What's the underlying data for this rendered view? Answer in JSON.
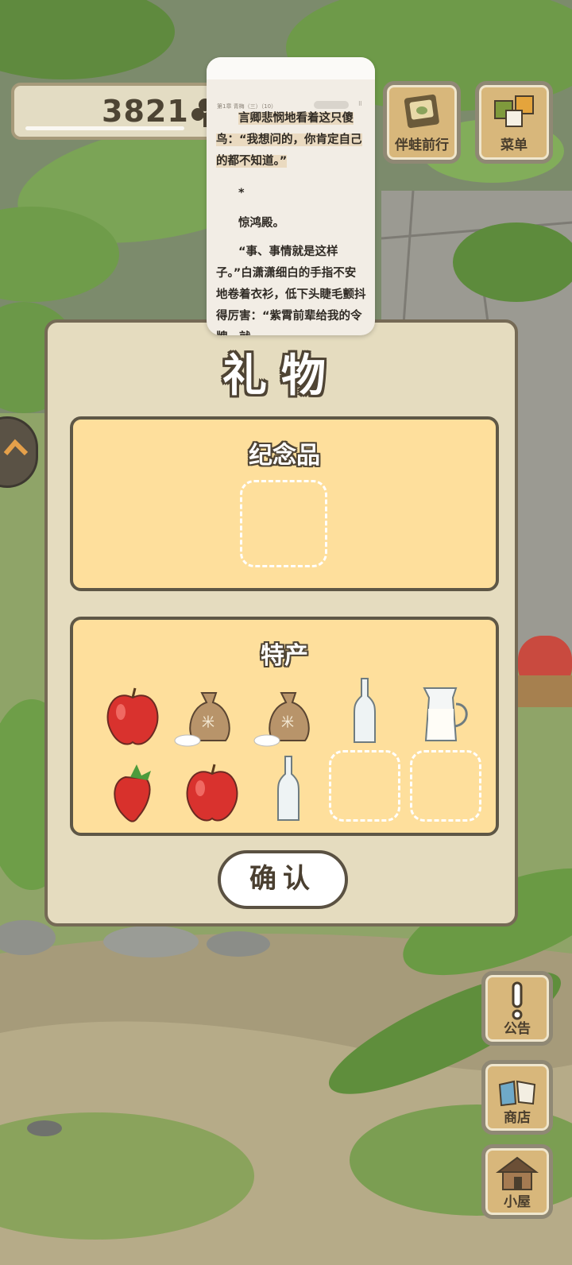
{
  "clover": {
    "count": "3821",
    "icon": "clover-icon"
  },
  "top_buttons": [
    {
      "label": "伴蛙前行",
      "icon": "journal-icon"
    },
    {
      "label": "菜单",
      "icon": "menu-icon"
    }
  ],
  "reader": {
    "chapter": "第1章 青梅（三）（10）",
    "paragraphs": [
      "言卿悲悯地看着这只傻鸟：“我想问的，你肯定自己的都不知道。”",
      "*",
      "惊鸿殿。",
      "“事、事情就是这样子。”白潇潇细白的手指不安地卷着衣衫，低下头睫毛颤抖得厉害：“紫霄前辈给我的令牌，就"
    ]
  },
  "gift": {
    "title": "礼物",
    "souvenir_label": "纪念品",
    "specialty_label": "特产",
    "specialty_items": [
      {
        "name": "apple-icon"
      },
      {
        "name": "rice-bag-icon"
      },
      {
        "name": "rice-bag-icon"
      },
      {
        "name": "glass-bottle-icon"
      },
      {
        "name": "milk-jug-icon"
      },
      {
        "name": "strawberry-icon"
      },
      {
        "name": "apple-icon"
      },
      {
        "name": "glass-bottle-icon"
      }
    ],
    "confirm_label": "确认"
  },
  "side_buttons": [
    {
      "label": "公告",
      "icon": "exclamation-icon"
    },
    {
      "label": "商店",
      "icon": "shop-bags-icon"
    },
    {
      "label": "小屋",
      "icon": "house-icon"
    }
  ],
  "colors": {
    "panel_bg": "#e5dcbf",
    "box_bg": "#fedf9c",
    "button_bg": "#d8b77b",
    "outline": "#5e5746"
  }
}
